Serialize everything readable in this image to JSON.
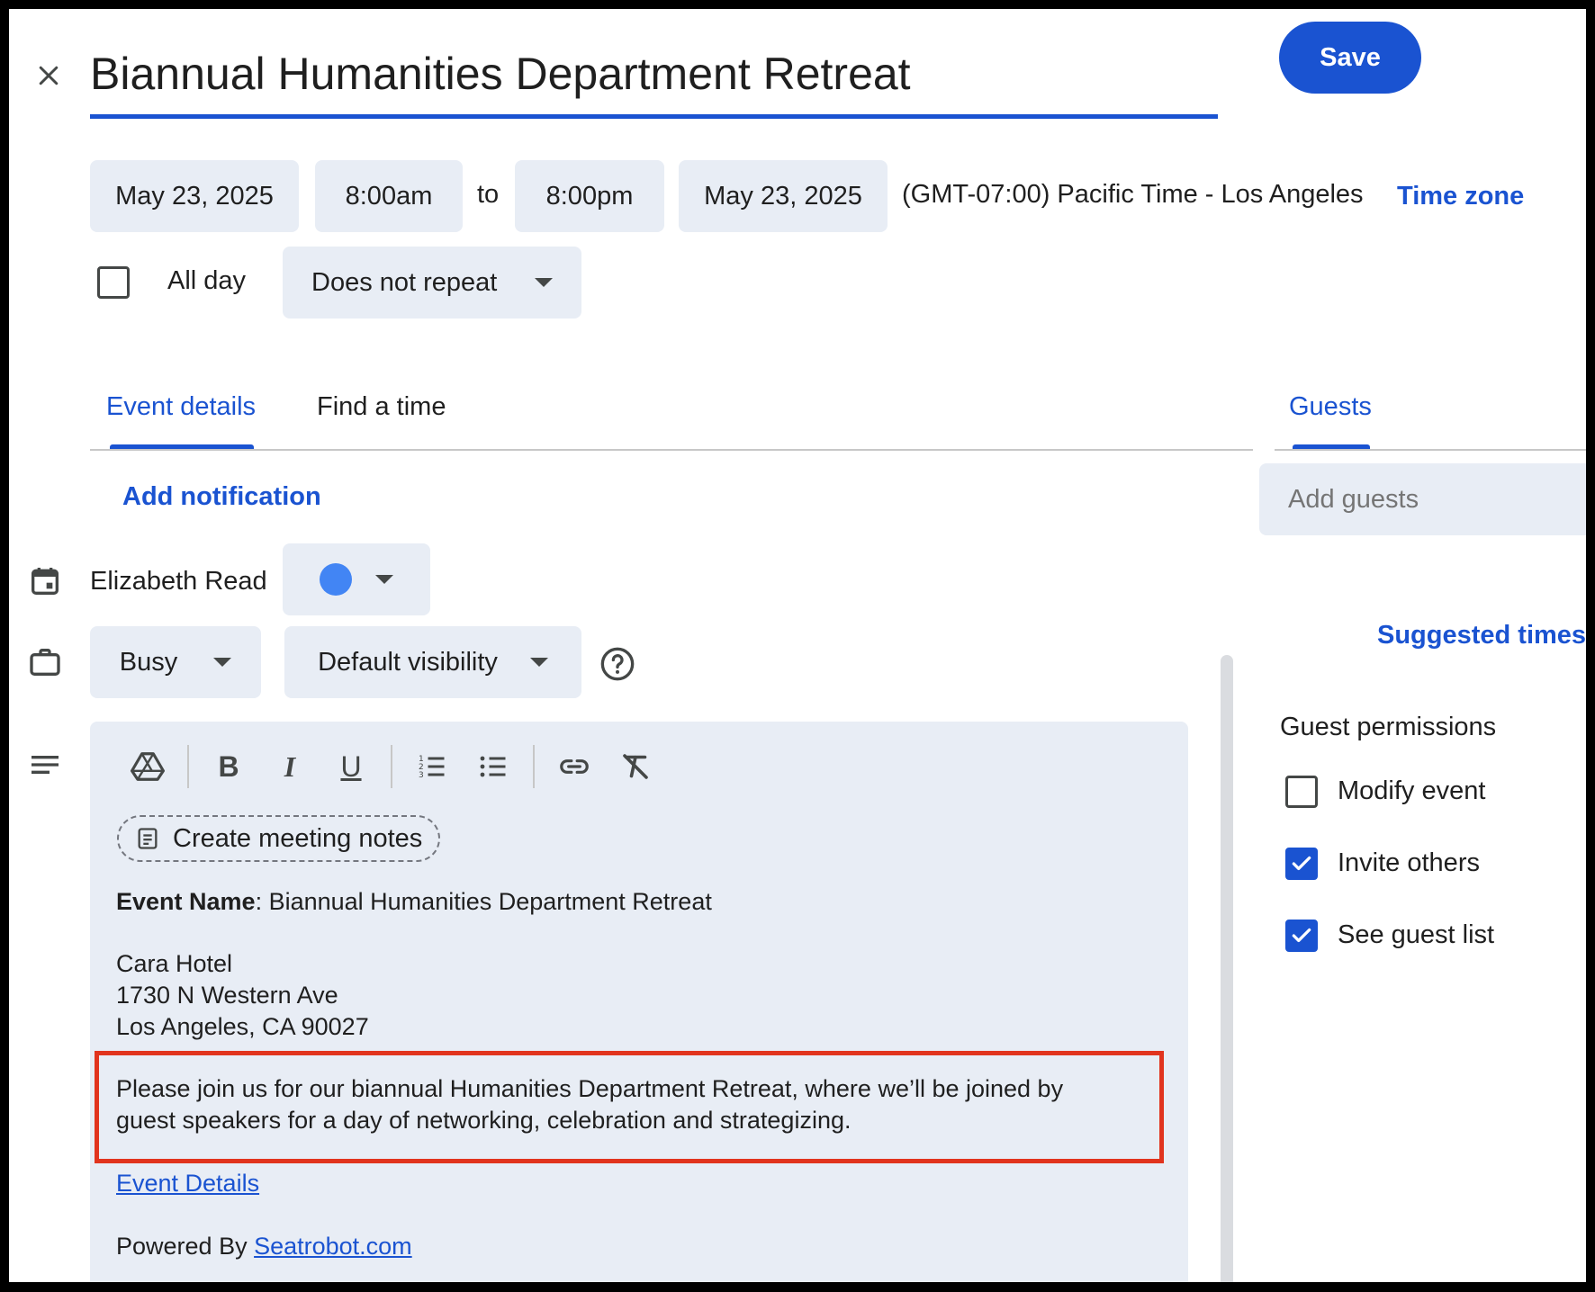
{
  "header": {
    "title": "Biannual Humanities Department Retreat",
    "save_label": "Save"
  },
  "datetime": {
    "start_date": "May 23, 2025",
    "start_time": "8:00am",
    "to_label": "to",
    "end_time": "8:00pm",
    "end_date": "May 23, 2025",
    "timezone_text": "(GMT-07:00) Pacific Time - Los Angeles",
    "timezone_link": "Time zone",
    "all_day_label": "All day",
    "all_day_checked": false,
    "repeat_value": "Does not repeat"
  },
  "tabs": {
    "event_details": "Event details",
    "find_a_time": "Find a time",
    "guests": "Guests"
  },
  "details": {
    "add_notification": "Add notification",
    "calendar_owner": "Elizabeth Read",
    "calendar_color": "#4285f4",
    "busy_value": "Busy",
    "visibility_value": "Default visibility"
  },
  "editor": {
    "create_meeting_notes": "Create meeting notes",
    "event_name_label": "Event Name",
    "event_name_value": ": Biannual Humanities Department Retreat",
    "venue_name": "Cara Hotel",
    "venue_street": "1730 N Western Ave",
    "venue_city": "Los Angeles, CA 90027",
    "invite_line1": "Please join us for our biannual Humanities Department Retreat, where we’ll be joined by",
    "invite_line2": "guest speakers for a day of networking, celebration and strategizing.",
    "event_details_link": "Event Details",
    "powered_by": "Powered By ",
    "powered_by_link": "Seatrobot.com"
  },
  "guests": {
    "add_guests_placeholder": "Add guests",
    "suggested_times": "Suggested times",
    "permissions_title": "Guest permissions",
    "permissions": [
      {
        "label": "Modify event",
        "checked": false
      },
      {
        "label": "Invite others",
        "checked": true
      },
      {
        "label": "See guest list",
        "checked": true
      }
    ]
  },
  "colors": {
    "accent": "#1a53d1",
    "highlight_border": "#e1341e",
    "field_bg": "#e8edf5"
  }
}
